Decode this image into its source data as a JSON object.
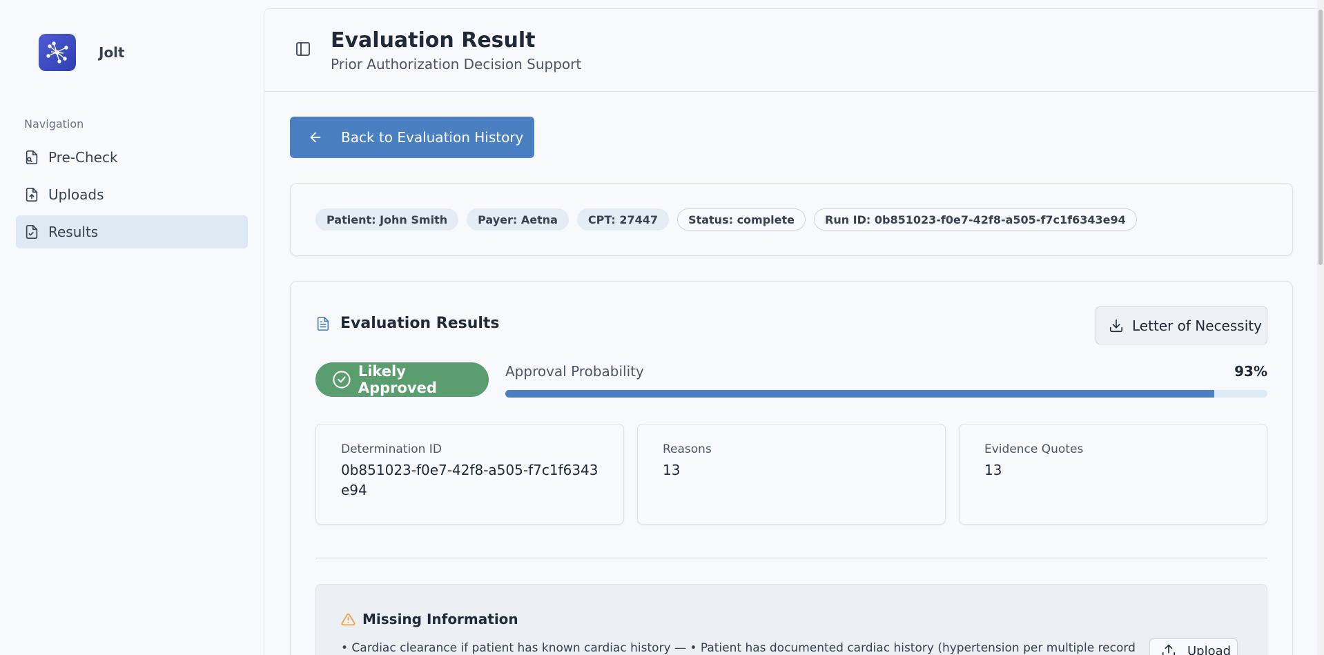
{
  "app": {
    "name": "Jolt"
  },
  "nav": {
    "heading": "Navigation",
    "items": [
      {
        "label": "Pre-Check",
        "icon": "file-search-icon",
        "active": false
      },
      {
        "label": "Uploads",
        "icon": "file-upload-icon",
        "active": false
      },
      {
        "label": "Results",
        "icon": "file-check-icon",
        "active": true
      }
    ]
  },
  "header": {
    "title": "Evaluation Result",
    "subtitle": "Prior Authorization Decision Support"
  },
  "back_button": {
    "label": "Back to Evaluation History"
  },
  "meta_chips": [
    "Patient: John Smith",
    "Payer: Aetna",
    "CPT: 27447",
    "Status: complete",
    "Run ID: 0b851023-f0e7-42f8-a505-f7c1f6343e94"
  ],
  "results": {
    "title": "Evaluation Results",
    "letter_button": "Letter of Necessity",
    "decision": "Likely Approved",
    "probability_label": "Approval Probability",
    "probability_text": "93%",
    "probability": 0.93,
    "stats": [
      {
        "label": "Determination ID",
        "value": "0b851023-f0e7-42f8-a505-f7c1f6343e94"
      },
      {
        "label": "Reasons",
        "value": "13"
      },
      {
        "label": "Evidence Quotes",
        "value": "13"
      }
    ]
  },
  "missing": {
    "title": "Missing Information",
    "item": "•  Cardiac clearance if patient has known cardiac history — • Patient has documented cardiac history (hypertension per multiple records) •",
    "upload_label": "Upload"
  },
  "colors": {
    "accent": "#4a7fc1",
    "success": "#5a9e6f",
    "warning": "#e8a33d",
    "active_nav": "#dde9f3"
  }
}
